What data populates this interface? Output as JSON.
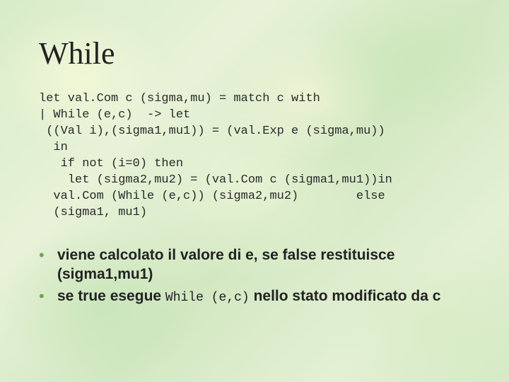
{
  "title": "While",
  "code": "let val.Com c (sigma,mu) = match c with\n| While (e,c)  -> let\n ((Val i),(sigma1,mu1)) = (val.Exp e (sigma,mu))\n  in\n   if not (i=0) then\n    let (sigma2,mu2) = (val.Com c (sigma1,mu1))in\n  val.Com (While (e,c)) (sigma2,mu2)        else\n  (sigma1, mu1)",
  "bullets": [
    {
      "pre": "viene calcolato il valore di e, se false restituisce (sigma1,mu1)",
      "code": "",
      "post": ""
    },
    {
      "pre": "se true esegue ",
      "code": "While (e,c)",
      "post": "   nello stato modificato da c"
    }
  ]
}
